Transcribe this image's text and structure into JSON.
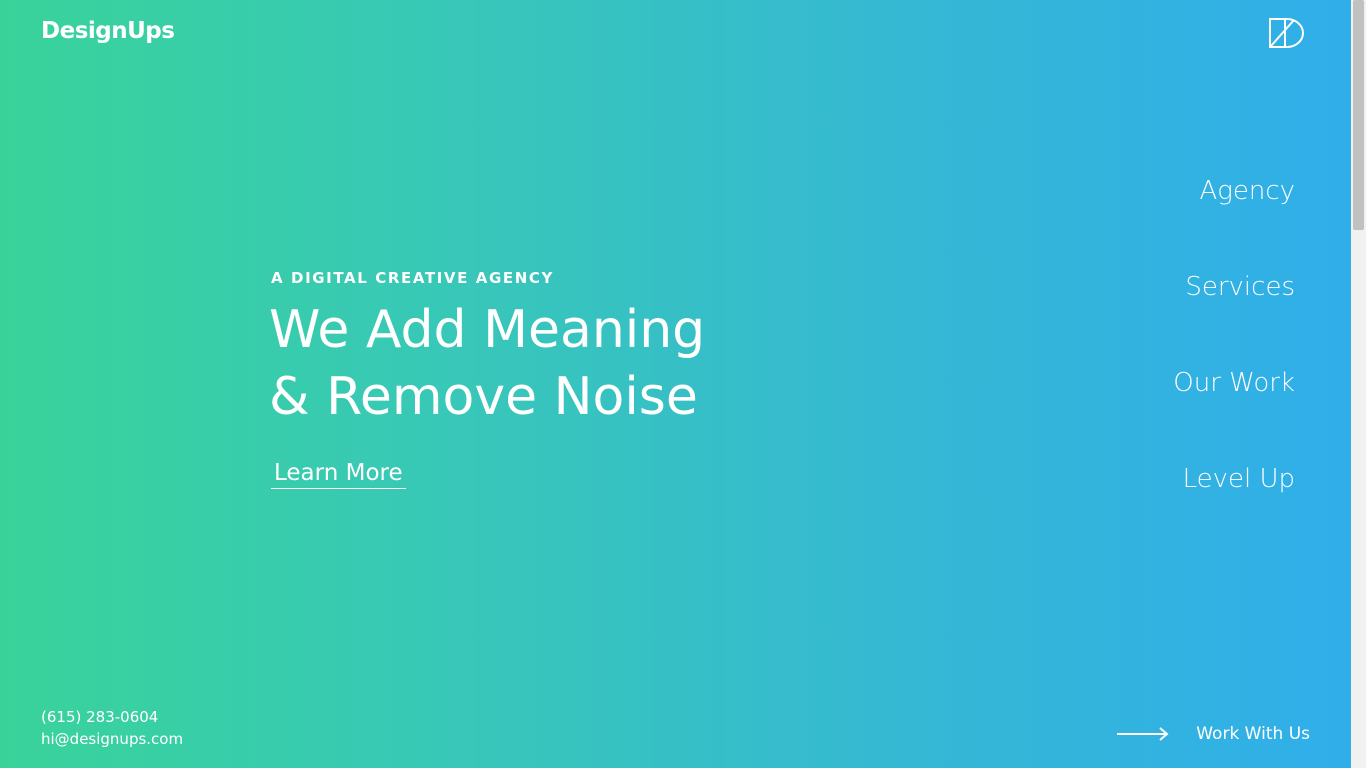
{
  "brand": {
    "name": "DesignUps",
    "mark_icon": "designups-logo-icon"
  },
  "nav": {
    "items": [
      {
        "label": "Agency"
      },
      {
        "label": "Services"
      },
      {
        "label": "Our Work"
      },
      {
        "label": "Level Up"
      }
    ]
  },
  "hero": {
    "eyebrow": "A DIGITAL CREATIVE AGENCY",
    "headline_line1": "We Add Meaning",
    "headline_line2": "& Remove Noise",
    "learn_more_label": "Learn More"
  },
  "contact": {
    "phone": "(615) 283-0604",
    "email": "hi@designups.com"
  },
  "cta": {
    "label": "Work With Us",
    "icon": "arrow-right-icon"
  },
  "colors": {
    "gradient_start": "#39d39a",
    "gradient_end": "#30aeea",
    "text": "#ffffff"
  }
}
